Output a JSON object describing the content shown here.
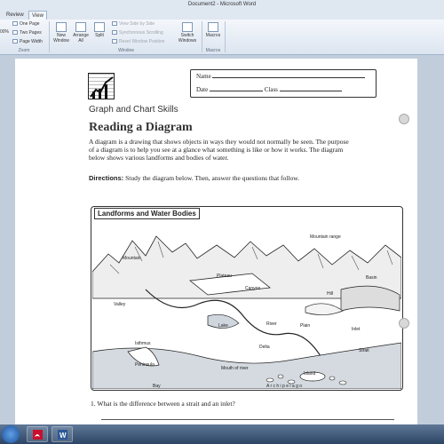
{
  "window": {
    "title": "Document2 - Microsoft Word"
  },
  "ribbon": {
    "tabs": [
      "Review",
      "View"
    ],
    "zoom_group": {
      "percent": "00%",
      "one_page": "One Page",
      "two_pages": "Two Pages",
      "page_width": "Page Width",
      "label": "Zoom"
    },
    "window_group": {
      "new_window": "New Window",
      "arrange_all": "Arrange All",
      "split": "Split",
      "side_by_side": "View Side by Side",
      "sync_scroll": "Synchronous Scrolling",
      "reset_pos": "Reset Window Position",
      "switch_windows": "Switch Windows",
      "label": "Window"
    },
    "macros_group": {
      "macros": "Macros",
      "label": "Macros"
    }
  },
  "document": {
    "name_label": "Name",
    "date_label": "Date",
    "class_label": "Class",
    "section": "Graph and Chart Skills",
    "heading": "Reading a Diagram",
    "intro": "A diagram is a drawing that shows objects in ways they would not normally be seen. The purpose of a diagram is to help you see at a glance what something is like or how it works. The diagram below shows various landforms and bodies of water.",
    "directions_label": "Directions:",
    "directions_text": "Study the diagram below. Then, answer the questions that follow.",
    "diagram_title": "Landforms and Water Bodies",
    "question_1": "1.  What is the difference between a strait and an inlet?"
  },
  "diagram_labels": {
    "mountain_range": "Mountain range",
    "mountain": "Mountain",
    "plateau": "Plateau",
    "basin": "Basin",
    "canyon": "Canyon",
    "hill": "Hill",
    "valley": "Valley",
    "lake": "Lake",
    "river": "River",
    "plain": "Plain",
    "inlet": "Inlet",
    "isthmus": "Isthmus",
    "delta": "Delta",
    "strait": "Strait",
    "peninsula": "Peninsula",
    "mouth_of_river": "Mouth of river",
    "island": "Island",
    "archipelago": "A r c h i p e l a g o",
    "bay": "Bay"
  },
  "taskbar": {
    "time": "",
    "date": ""
  }
}
